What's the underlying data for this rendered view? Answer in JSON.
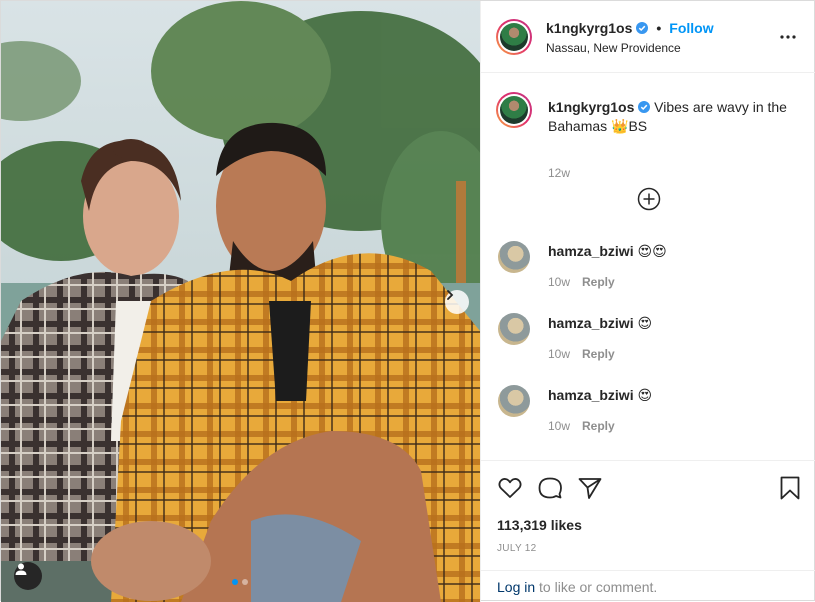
{
  "post": {
    "username": "k1ngkyrg1os",
    "follow_label": "Follow",
    "separator": "•",
    "location": "Nassau, New Providence",
    "caption_text": "Vibes are wavy in the Bahamas 👑BS",
    "caption_time": "12w",
    "likes": "113,319 likes",
    "date": "JULY 12",
    "carousel_count": 2,
    "carousel_active": 1
  },
  "comments": [
    {
      "username": "hamza_bziwi",
      "text": "😍😍",
      "time": "10w",
      "reply_label": "Reply"
    },
    {
      "username": "hamza_bziwi",
      "text": "😍",
      "time": "10w",
      "reply_label": "Reply"
    },
    {
      "username": "hamza_bziwi",
      "text": "😍",
      "time": "10w",
      "reply_label": "Reply"
    }
  ],
  "login_bar": {
    "link_label": "Log in",
    "rest": " to like or comment."
  },
  "icons": {
    "more": "more-options-icon",
    "verified": "verified-badge-icon",
    "load_more": "plus-circle-icon",
    "like": "heart-icon",
    "comment": "comment-bubble-icon",
    "share": "paper-plane-icon",
    "save": "bookmark-icon",
    "next": "chevron-right-icon",
    "tag": "user-tag-icon"
  },
  "colors": {
    "accent": "#0095f6",
    "text": "#262626",
    "muted": "#8e8e8e"
  }
}
